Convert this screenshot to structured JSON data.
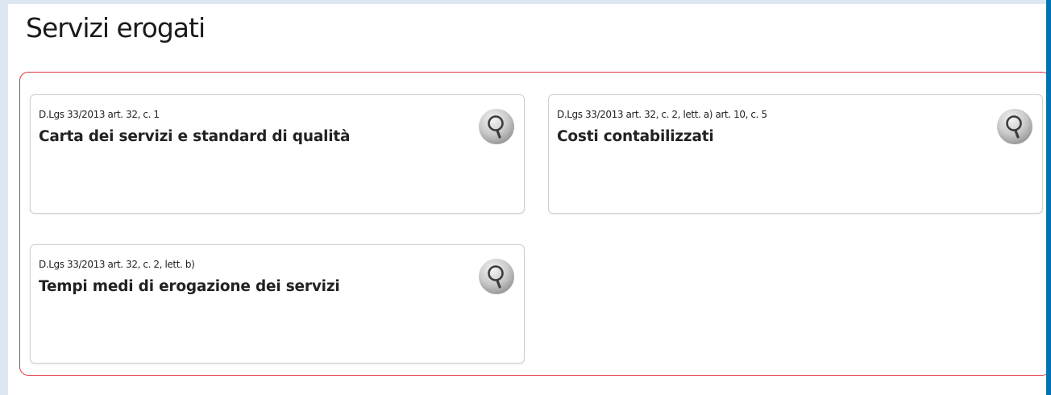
{
  "page_title": "Servizi erogati",
  "colors": {
    "section_border": "#e0303f",
    "right_accent": "#0073b4",
    "card_border": "#cfcfcf"
  },
  "cards": [
    {
      "reference": "D.Lgs 33/2013 art. 32, c. 1",
      "title": "Carta dei servizi e standard di qualità",
      "icon": "magnifier-icon"
    },
    {
      "reference": "D.Lgs 33/2013 art. 32, c. 2, lett. a) art. 10, c. 5",
      "title": "Costi contabilizzati",
      "icon": "magnifier-icon"
    },
    {
      "reference": "D.Lgs 33/2013 art. 32, c. 2, lett. b)",
      "title": "Tempi medi di erogazione dei servizi",
      "icon": "magnifier-icon"
    }
  ]
}
